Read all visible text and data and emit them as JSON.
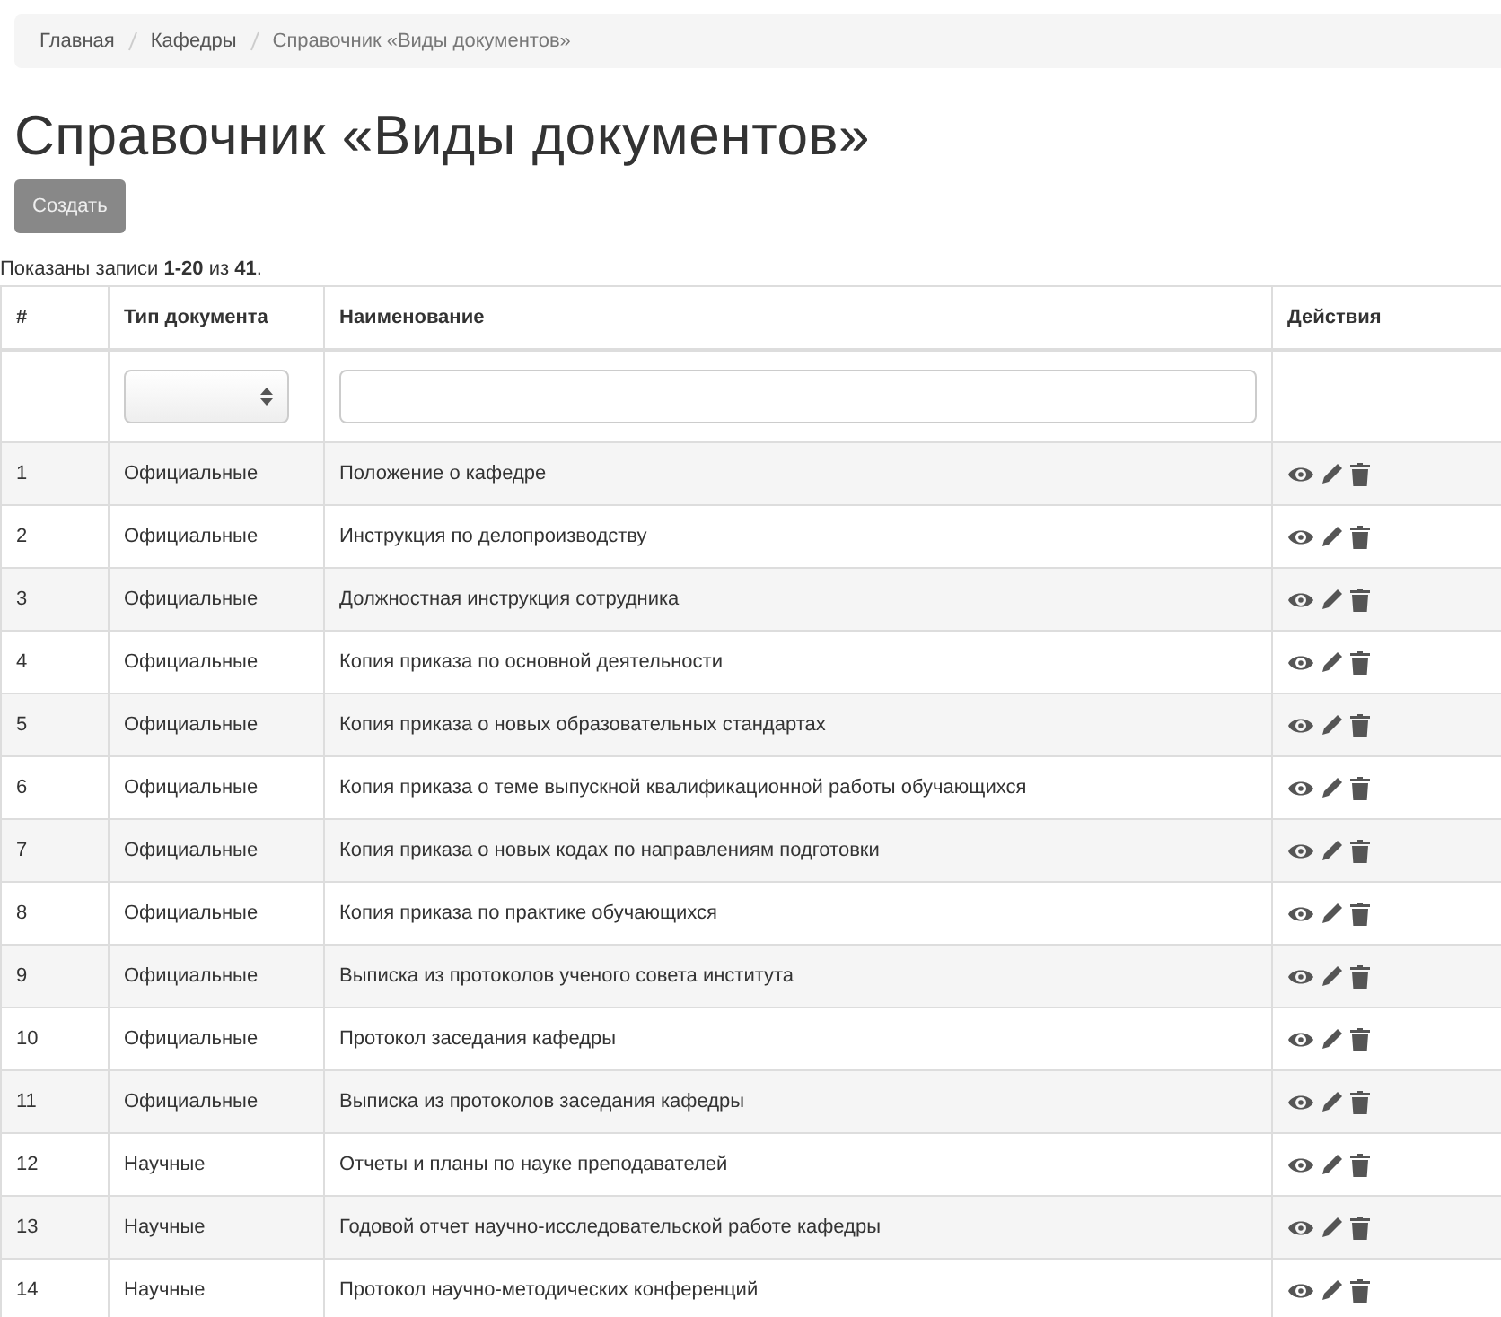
{
  "breadcrumb": [
    {
      "label": "Главная",
      "kind": "link"
    },
    {
      "label": "Кафедры",
      "kind": "link"
    },
    {
      "label": "Справочник «Виды документов»",
      "kind": "current"
    }
  ],
  "title": "Справочник «Виды документов»",
  "create_button": {
    "label": "Создать"
  },
  "summary": "Показаны записи **1-20** из **41**.",
  "table": {
    "columns": [
      "#",
      "Тип документа",
      "Наименование",
      "Действия"
    ],
    "filters": {
      "type": {
        "kind": "select"
      },
      "name": {
        "kind": "text"
      }
    },
    "rows": [
      {
        "num": "1",
        "type": "Официальные",
        "name": "Положение о кафедре"
      },
      {
        "num": "2",
        "type": "Официальные",
        "name": "Инструкция по делопроизводству"
      },
      {
        "num": "3",
        "type": "Официальные",
        "name": "Должностная инструкция сотрудника"
      },
      {
        "num": "4",
        "type": "Официальные",
        "name": "Копия приказа по основной деятельности"
      },
      {
        "num": "5",
        "type": "Официальные",
        "name": "Копия приказа о новых образовательных стандартах"
      },
      {
        "num": "6",
        "type": "Официальные",
        "name": "Копия приказа о теме выпускной квалификационной работы обучающихся"
      },
      {
        "num": "7",
        "type": "Официальные",
        "name": "Копия приказа о новых кодах по направлениям подготовки"
      },
      {
        "num": "8",
        "type": "Официальные",
        "name": "Копия приказа по практике обучающихся"
      },
      {
        "num": "9",
        "type": "Официальные",
        "name": "Выписка из протоколов ученого совета института"
      },
      {
        "num": "10",
        "type": "Официальные",
        "name": "Протокол заседания кафедры"
      },
      {
        "num": "11",
        "type": "Официальные",
        "name": "Выписка из протоколов заседания кафедры"
      },
      {
        "num": "12",
        "type": "Научные",
        "name": "Отчеты и планы по науке преподавателей"
      },
      {
        "num": "13",
        "type": "Научные",
        "name": "Годовой отчет научно-исследовательской работе кафедры"
      },
      {
        "num": "14",
        "type": "Научные",
        "name": "Протокол научно-методических конференций"
      }
    ]
  }
}
